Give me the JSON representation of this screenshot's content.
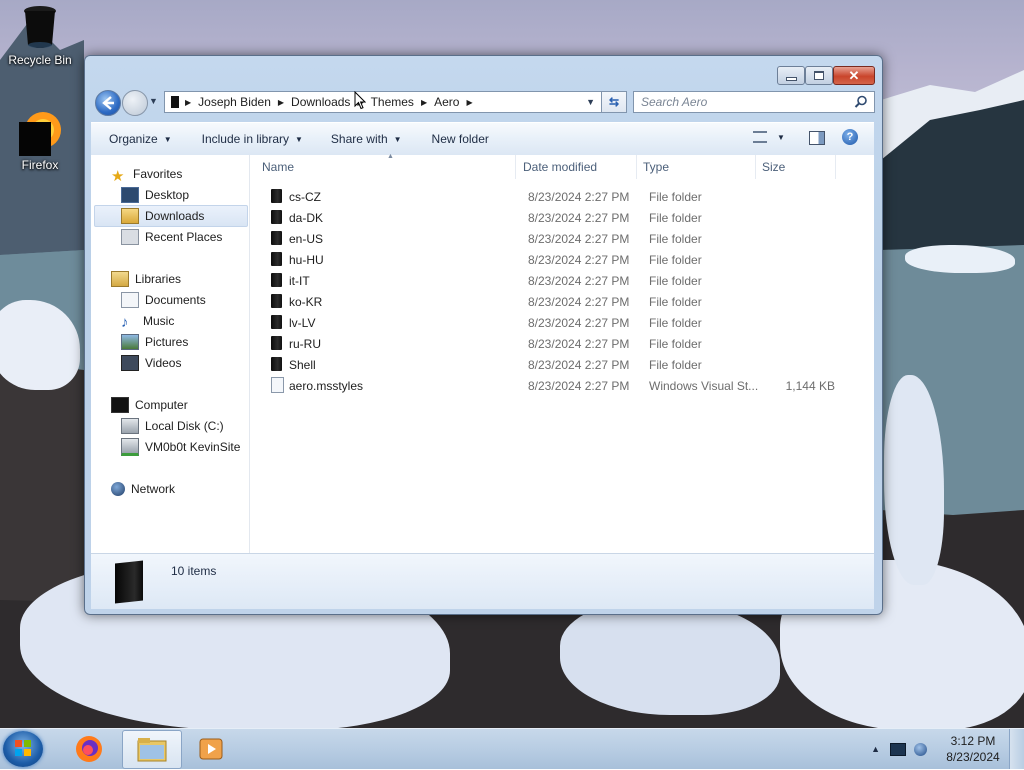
{
  "desktop": {
    "icons": [
      {
        "label": "Recycle Bin",
        "icon": "recycle-bin-icon"
      },
      {
        "label": "Firefox",
        "icon": "firefox-icon"
      }
    ]
  },
  "window": {
    "breadcrumbs": [
      "Joseph Biden",
      "Downloads",
      "Themes",
      "Aero"
    ],
    "search_placeholder": "Search Aero",
    "toolbar": {
      "organize": "Organize",
      "include_in_library": "Include in library",
      "share_with": "Share with",
      "new_folder": "New folder"
    },
    "nav": {
      "favorites": "Favorites",
      "desktop": "Desktop",
      "downloads": "Downloads",
      "recent_places": "Recent Places",
      "libraries": "Libraries",
      "documents": "Documents",
      "music": "Music",
      "pictures": "Pictures",
      "videos": "Videos",
      "computer": "Computer",
      "local_disk": "Local Disk (C:)",
      "network_drive": "VM0b0t KevinSite",
      "network": "Network"
    },
    "columns": {
      "name": "Name",
      "date": "Date modified",
      "type": "Type",
      "size": "Size"
    },
    "files": [
      {
        "name": "cs-CZ",
        "date": "8/23/2024 2:27 PM",
        "type": "File folder",
        "size": ""
      },
      {
        "name": "da-DK",
        "date": "8/23/2024 2:27 PM",
        "type": "File folder",
        "size": ""
      },
      {
        "name": "en-US",
        "date": "8/23/2024 2:27 PM",
        "type": "File folder",
        "size": ""
      },
      {
        "name": "hu-HU",
        "date": "8/23/2024 2:27 PM",
        "type": "File folder",
        "size": ""
      },
      {
        "name": "it-IT",
        "date": "8/23/2024 2:27 PM",
        "type": "File folder",
        "size": ""
      },
      {
        "name": "ko-KR",
        "date": "8/23/2024 2:27 PM",
        "type": "File folder",
        "size": ""
      },
      {
        "name": "lv-LV",
        "date": "8/23/2024 2:27 PM",
        "type": "File folder",
        "size": ""
      },
      {
        "name": "ru-RU",
        "date": "8/23/2024 2:27 PM",
        "type": "File folder",
        "size": ""
      },
      {
        "name": "Shell",
        "date": "8/23/2024 2:27 PM",
        "type": "File folder",
        "size": ""
      },
      {
        "name": "aero.msstyles",
        "date": "8/23/2024 2:27 PM",
        "type": "Windows Visual St...",
        "size": "1,144 KB"
      }
    ],
    "status": {
      "items_count": "10 items"
    }
  },
  "taskbar": {
    "clock_time": "3:12 PM",
    "clock_date": "8/23/2024"
  }
}
